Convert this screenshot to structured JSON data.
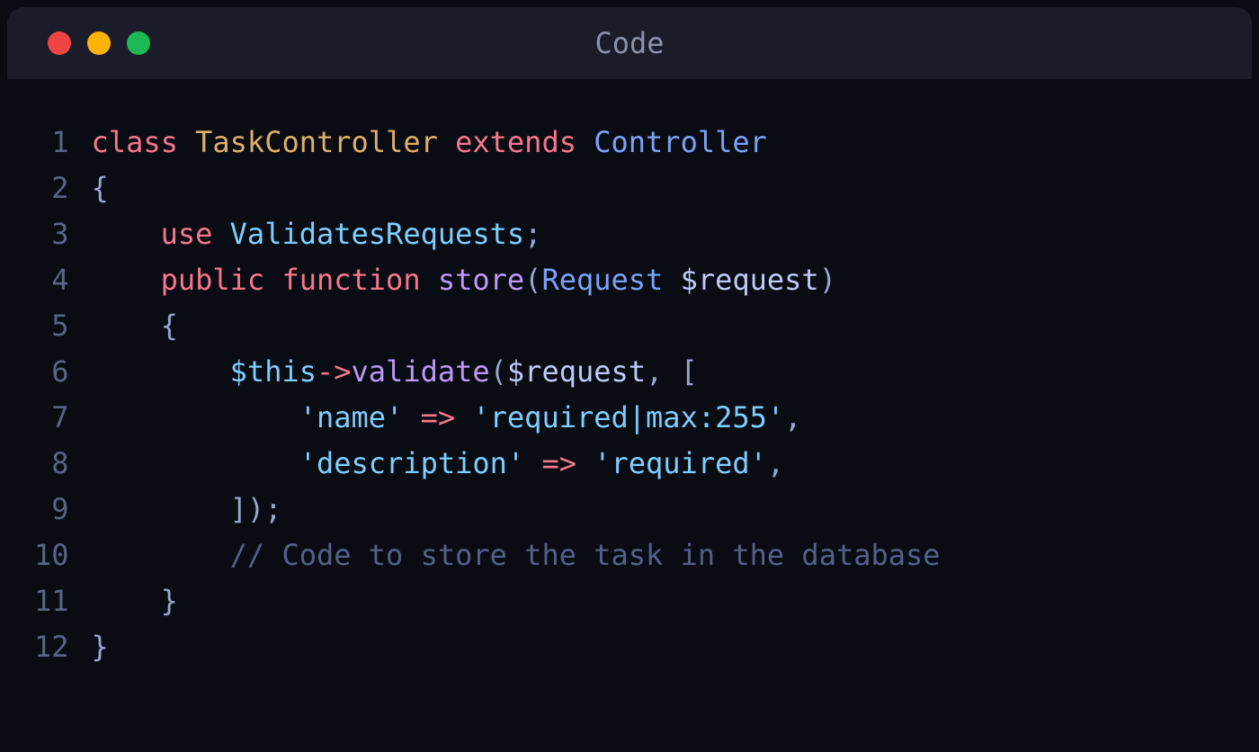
{
  "window": {
    "title": "Code"
  },
  "code": {
    "line_count": 12,
    "lines": {
      "1": {
        "class_kw": "class",
        "class_name": "TaskController",
        "extends_kw": "extends",
        "parent_class": "Controller"
      },
      "2": {
        "brace": "{"
      },
      "3": {
        "indent": "    ",
        "use_kw": "use",
        "trait": "ValidatesRequests",
        "semi": ";"
      },
      "4": {
        "indent": "    ",
        "visibility": "public",
        "function_kw": "function",
        "method_name": "store",
        "paren_open": "(",
        "param_type": "Request",
        "param_name": "$request",
        "paren_close": ")"
      },
      "5": {
        "indent": "    ",
        "brace": "{"
      },
      "6": {
        "indent": "        ",
        "this": "$this",
        "arrow": "->",
        "method": "validate",
        "paren_open": "(",
        "arg1": "$request",
        "comma": ", ",
        "bracket": "["
      },
      "7": {
        "indent": "            ",
        "key": "'name'",
        "arrow": " => ",
        "value": "'required|max:255'",
        "comma": ","
      },
      "8": {
        "indent": "            ",
        "key": "'description'",
        "arrow": " => ",
        "value": "'required'",
        "comma": ","
      },
      "9": {
        "indent": "        ",
        "close": "]);"
      },
      "10": {
        "indent": "        ",
        "comment": "// Code to store the task in the database"
      },
      "11": {
        "indent": "    ",
        "brace": "}"
      },
      "12": {
        "brace": "}"
      }
    }
  }
}
